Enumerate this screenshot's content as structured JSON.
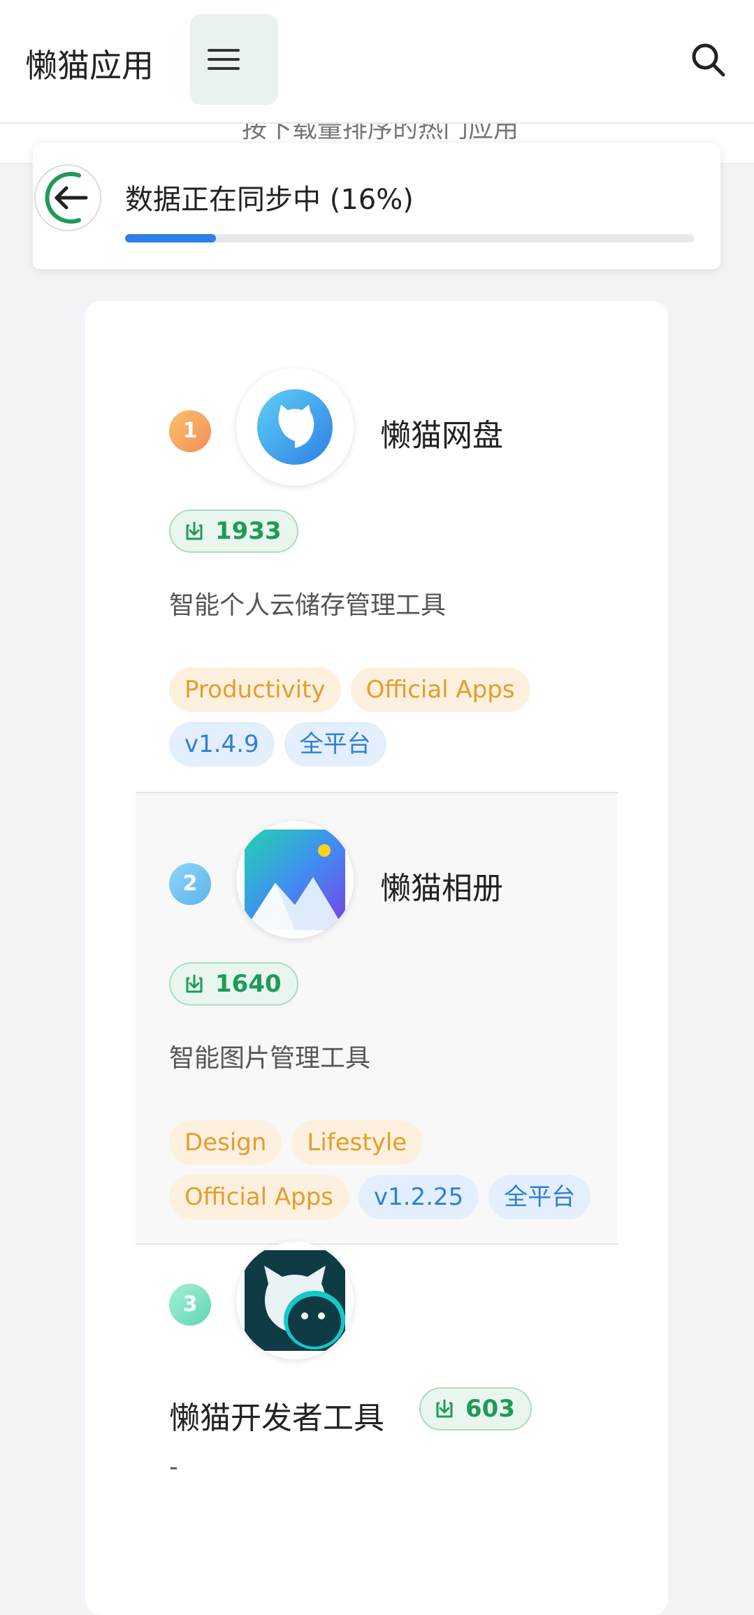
{
  "header": {
    "app_title": "懒猫应用",
    "menu_icon": "menu-icon",
    "search_icon": "search-icon",
    "subtitle_partial": "按下载量排序的热门应用"
  },
  "sync": {
    "message": "数据正在同步中 (16%)",
    "progress_percent": 16,
    "back_icon": "arrow-left-icon",
    "colors": {
      "spinner": "#1f9a59",
      "bar": "#2d7ee8"
    }
  },
  "apps": [
    {
      "rank": "1",
      "name": "懒猫网盘",
      "downloads": "1933",
      "description": "智能个人云储存管理工具",
      "tags_orange": [
        "Productivity",
        "Official Apps"
      ],
      "tags_blue": [
        "v1.4.9",
        "全平台"
      ],
      "rank_color": "#f7a55e"
    },
    {
      "rank": "2",
      "name": "懒猫相册",
      "downloads": "1640",
      "description": "智能图片管理工具",
      "tags_orange": [
        "Design",
        "Lifestyle",
        "Official Apps"
      ],
      "tags_blue": [
        "v1.2.25",
        "全平台"
      ],
      "rank_color": "#6cc0f4"
    },
    {
      "rank": "3",
      "name": "懒猫开发者工具",
      "downloads": "603",
      "description": "-",
      "rank_color": "#7fe0c4"
    }
  ]
}
